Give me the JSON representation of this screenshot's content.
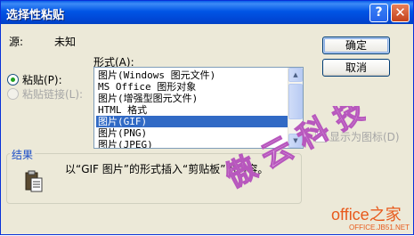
{
  "window": {
    "title": "选择性粘贴",
    "help_glyph": "?",
    "close_glyph": "✕"
  },
  "source": {
    "label": "源:",
    "value": "未知"
  },
  "as": {
    "label": "形式(A):",
    "items": [
      {
        "label": "图片(Windows 图元文件)",
        "selected": false
      },
      {
        "label": "MS Office 图形对象",
        "selected": false
      },
      {
        "label": "图片(增强型图元文件)",
        "selected": false
      },
      {
        "label": "HTML 格式",
        "selected": false
      },
      {
        "label": "图片(GIF)",
        "selected": true
      },
      {
        "label": "图片(PNG)",
        "selected": false
      },
      {
        "label": "图片(JPEG)",
        "selected": false
      }
    ]
  },
  "options": {
    "paste_label": "粘贴(P):",
    "paste_link_label": "粘贴链接(L):"
  },
  "buttons": {
    "ok": "确定",
    "cancel": "取消"
  },
  "display_as_icon": {
    "label": "显示为图标(D)"
  },
  "result": {
    "title": "结果",
    "text": "以“GIF 图片”的形式插入“剪贴板”的内容。",
    "icon": "clipboard-icon"
  },
  "watermark": {
    "text": "傲 云 科 技"
  },
  "logo": {
    "main": "office之家",
    "sub": "OFFICE.JB51.NET"
  },
  "colors": {
    "title_bar": "#0055e5",
    "selection": "#316ac5",
    "dialog_bg": "#ece9d8",
    "logo": "#e85a1c",
    "watermark": "#d48ad8"
  }
}
